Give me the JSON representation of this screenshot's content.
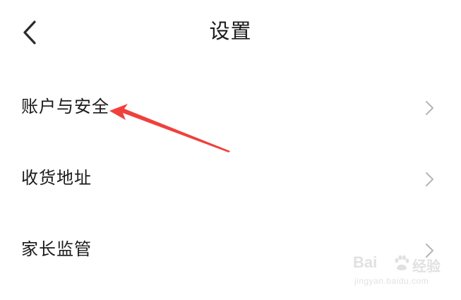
{
  "header": {
    "back_icon": "chevron-left-icon",
    "title": "设置"
  },
  "menu": {
    "items": [
      {
        "label": "账户与安全",
        "icon": "chevron-right-icon"
      },
      {
        "label": "收货地址",
        "icon": "chevron-right-icon"
      },
      {
        "label": "家长监管",
        "icon": "chevron-right-icon"
      }
    ]
  },
  "annotation": {
    "type": "red-arrow",
    "target": "账户与安全",
    "color": "#f0403c"
  },
  "watermark": {
    "brand": "Bai",
    "suffix": "经验",
    "url": "jingyan.baidu.com"
  },
  "colors": {
    "background": "#ffffff",
    "text": "#1a1a1a",
    "chevron": "#b5b5b5",
    "arrow": "#f0403c",
    "watermark": "#c9c9c9"
  }
}
